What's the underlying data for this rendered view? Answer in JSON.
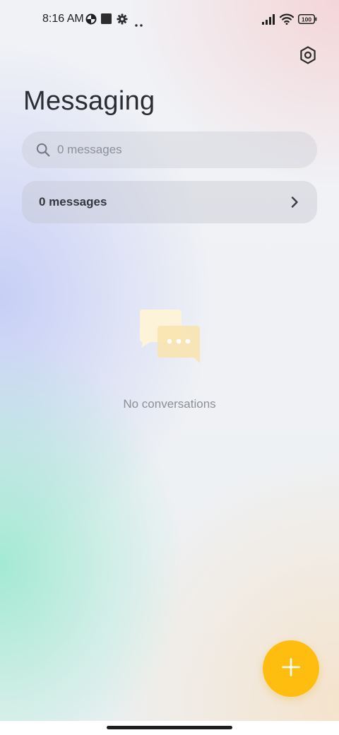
{
  "status_bar": {
    "time": "8:16 AM",
    "battery": "100",
    "left_icons": [
      "data-saver-icon",
      "square-notification-icon",
      "gear-notification-icon",
      "more-dots-icon"
    ],
    "right_icons": [
      "signal-icon",
      "wifi-icon",
      "battery-icon"
    ]
  },
  "header": {
    "title": "Messaging",
    "settings_icon": "settings-hexagon-icon"
  },
  "search": {
    "placeholder": "0 messages",
    "icon": "search-icon"
  },
  "messages_row": {
    "label": "0 messages",
    "icon": "chevron-right-icon"
  },
  "empty_state": {
    "icon": "chat-bubbles-icon",
    "text": "No conversations"
  },
  "fab": {
    "icon": "plus-icon"
  },
  "colors": {
    "accent": "#ffbd10",
    "title_text": "#2a2d33",
    "secondary_text": "#8c8f96"
  }
}
